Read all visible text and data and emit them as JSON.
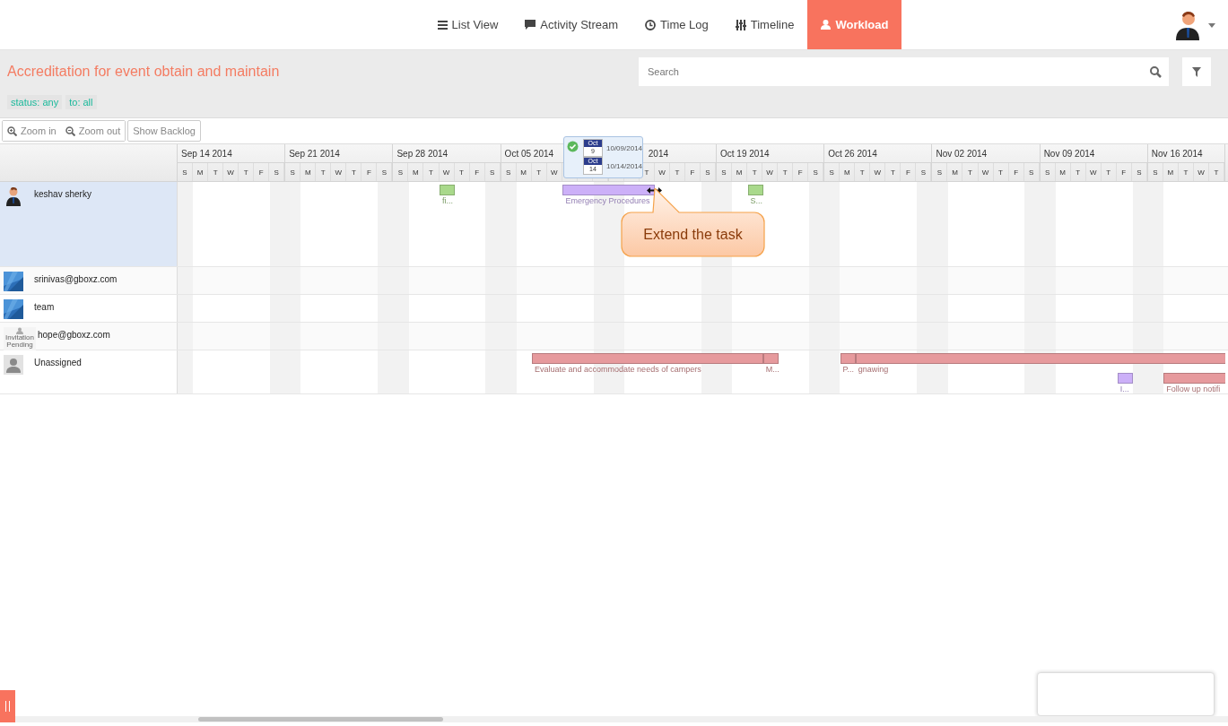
{
  "nav": {
    "tabs": [
      {
        "label": "List View",
        "selected": false
      },
      {
        "label": "Activity Stream",
        "selected": false
      },
      {
        "label": "Time Log",
        "selected": false
      },
      {
        "label": "Timeline",
        "selected": false
      },
      {
        "label": "Workload",
        "selected": true
      }
    ]
  },
  "project": {
    "title": "Accreditation for event obtain and maintain",
    "filters": [
      "status: any",
      "to: all"
    ]
  },
  "search": {
    "placeholder": "Search"
  },
  "toolbar": {
    "zoom": [
      "Zoom in",
      "Zoom out"
    ],
    "backlog": "Show Backlog"
  },
  "weeks": [
    {
      "label": "Sep 14 2014",
      "covered": false,
      "days": [
        {
          "label": "S"
        },
        {
          "label": "M"
        },
        {
          "label": "T"
        },
        {
          "label": "W"
        },
        {
          "label": "T"
        },
        {
          "label": "F"
        },
        {
          "label": "S"
        }
      ]
    },
    {
      "label": "Sep 21 2014",
      "covered": false,
      "days": [
        {
          "label": "S"
        },
        {
          "label": "M"
        },
        {
          "label": "T"
        },
        {
          "label": "W"
        },
        {
          "label": "T"
        },
        {
          "label": "F"
        },
        {
          "label": "S"
        }
      ]
    },
    {
      "label": "Sep 28 2014",
      "covered": false,
      "days": [
        {
          "label": "S"
        },
        {
          "label": "M"
        },
        {
          "label": "T"
        },
        {
          "label": "W"
        },
        {
          "label": "T"
        },
        {
          "label": "F"
        },
        {
          "label": "S"
        }
      ]
    },
    {
      "label": "Oct 05 2014",
      "covered": false,
      "days": [
        {
          "label": "S"
        },
        {
          "label": "M"
        },
        {
          "label": "T"
        },
        {
          "label": "W"
        },
        {
          "covered": true
        },
        {
          "covered": true
        },
        {
          "covered": true
        }
      ]
    },
    {
      "label": "2014",
      "covered": true,
      "days": [
        {
          "covered": true
        },
        {
          "covered": true
        },
        {
          "label": "T"
        },
        {
          "label": "W"
        },
        {
          "label": "T"
        },
        {
          "label": "F"
        },
        {
          "label": "S"
        }
      ]
    },
    {
      "label": "Oct 19 2014",
      "covered": false,
      "days": [
        {
          "label": "S"
        },
        {
          "label": "M"
        },
        {
          "label": "T"
        },
        {
          "label": "W"
        },
        {
          "label": "T"
        },
        {
          "label": "F"
        },
        {
          "label": "S"
        }
      ]
    },
    {
      "label": "Oct 26 2014",
      "covered": false,
      "days": [
        {
          "label": "S"
        },
        {
          "label": "M"
        },
        {
          "label": "T"
        },
        {
          "label": "W"
        },
        {
          "label": "T"
        },
        {
          "label": "F"
        },
        {
          "label": "S"
        }
      ]
    },
    {
      "label": "Nov 02 2014",
      "covered": false,
      "days": [
        {
          "label": "S"
        },
        {
          "label": "M"
        },
        {
          "label": "T"
        },
        {
          "label": "W"
        },
        {
          "label": "T"
        },
        {
          "label": "F"
        },
        {
          "label": "S"
        }
      ]
    },
    {
      "label": "Nov 09 2014",
      "covered": false,
      "days": [
        {
          "label": "S"
        },
        {
          "label": "M"
        },
        {
          "label": "T"
        },
        {
          "label": "W"
        },
        {
          "label": "T"
        },
        {
          "label": "F"
        },
        {
          "label": "S"
        }
      ]
    },
    {
      "label": "Nov 16 2014",
      "covered": false,
      "days": [
        {
          "label": "S"
        },
        {
          "label": "M"
        },
        {
          "label": "T"
        },
        {
          "label": "W"
        },
        {
          "label": "T"
        }
      ]
    }
  ],
  "tooltip": {
    "rows": [
      {
        "month": "Oct",
        "day": "9",
        "date": "10/09/2014"
      },
      {
        "month": "Oct",
        "day": "14",
        "date": "10/14/2014"
      }
    ]
  },
  "callout": "Extend the task",
  "people": [
    {
      "name": "keshav sherky",
      "avatar": {
        "kind": "person"
      },
      "selected": true,
      "tasks": [
        {
          "label": "fi...",
          "color": "#a9d98b"
        },
        {
          "label": "Emergency Procedures",
          "color": "#ccb0f8"
        },
        {
          "label": "S...",
          "color": "#a9d98b"
        }
      ]
    },
    {
      "name": "srinivas@gboxz.com",
      "selected": false
    },
    {
      "name": "team",
      "selected": false
    },
    {
      "name": "hope@gboxz.com",
      "avatar": {
        "kind": "pending",
        "caption": "Invitation Pending"
      },
      "selected": false
    },
    {
      "name": "Unassigned",
      "avatar": {
        "kind": "silhouette"
      },
      "selected": false,
      "tasks": [
        {
          "label": "Evaluate and accommodate needs of campers",
          "color": "#e69a9d"
        },
        {
          "label": "M...",
          "color": "#e69a9d"
        },
        {
          "label": "P...",
          "color": "#e69a9d"
        },
        {
          "label": "gnawing",
          "color": "#e69a9d"
        },
        {
          "label": "I...",
          "color": "#ccb0f8"
        },
        {
          "label": "Follow up notifi",
          "color": "#e69a9d"
        }
      ]
    }
  ]
}
